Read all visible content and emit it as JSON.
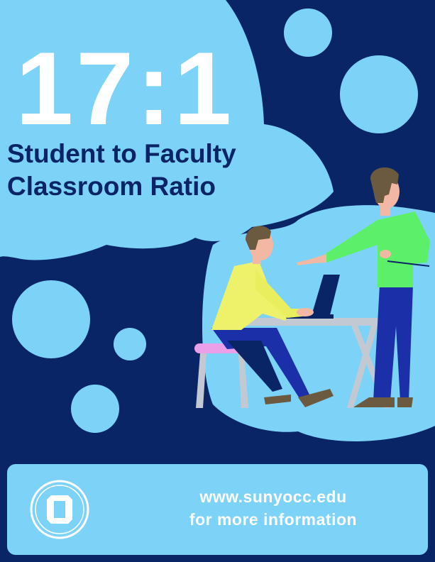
{
  "headline": {
    "ratio": "17:1",
    "subtitle_line1": "Student to Faculty",
    "subtitle_line2": "Classroom Ratio"
  },
  "footer": {
    "url": "www.sunyocc.edu",
    "info": "for more information",
    "logo_letter": "O"
  },
  "colors": {
    "navy": "#0a2566",
    "light_blue": "#7dd3f7",
    "white": "#ffffff"
  },
  "icons": {
    "logo": "occ-o-logo-icon",
    "illustration": "student-and-teacher-illustration"
  }
}
